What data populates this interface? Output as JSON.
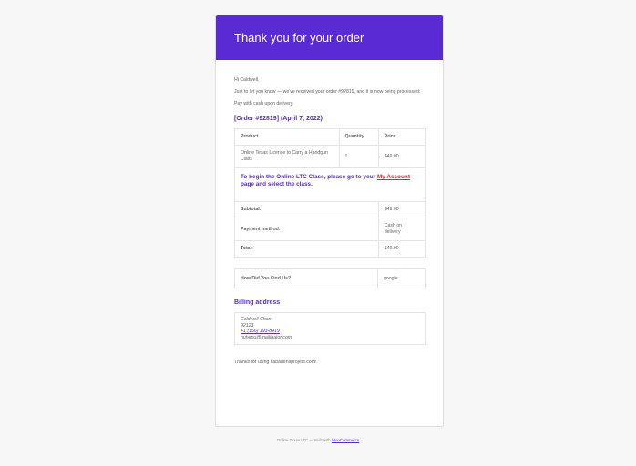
{
  "theme": {
    "accent": "#5a2bd4",
    "link_red": "#e0262b",
    "background": "#f7f7f7"
  },
  "email": {
    "header_title": "Thank you for your order",
    "greeting": "Hi Caldwell,",
    "intro": "Just to let you know — we've received your order #92819, and it is now being processed:",
    "payment_note": "Pay with cash upon delivery.",
    "order_heading": "[Order #92819] (April 7, 2022)",
    "table_headers": {
      "product": "Product",
      "quantity": "Quantity",
      "price": "Price"
    },
    "items": [
      {
        "product": "Online Texas License to Carry a Handgun Class",
        "quantity": "1",
        "price": "$49.00"
      }
    ],
    "ltc_note": {
      "before": "To begin the Online LTC Class, please go to your ",
      "link_text": "My Account",
      "after": " page and select the class."
    },
    "totals": [
      {
        "label": "Subtotal:",
        "value": "$49.00"
      },
      {
        "label": "Payment method:",
        "value": "Cash on delivery"
      },
      {
        "label": "Total:",
        "value": "$49.00"
      }
    ],
    "survey": {
      "question": "How Did You Find Us?",
      "answer": "google"
    },
    "billing": {
      "heading": "Billing address",
      "name": "Caldwell Chan",
      "postcode": "92123",
      "phone": "+1 (156) 193-8919",
      "email": "nuhepu@mailinator.com"
    },
    "thanks": "Thanks for using sabadensproject.com!"
  },
  "footer": {
    "prefix": "Online Texas LTC — Built with ",
    "link_text": "WooCommerce"
  }
}
